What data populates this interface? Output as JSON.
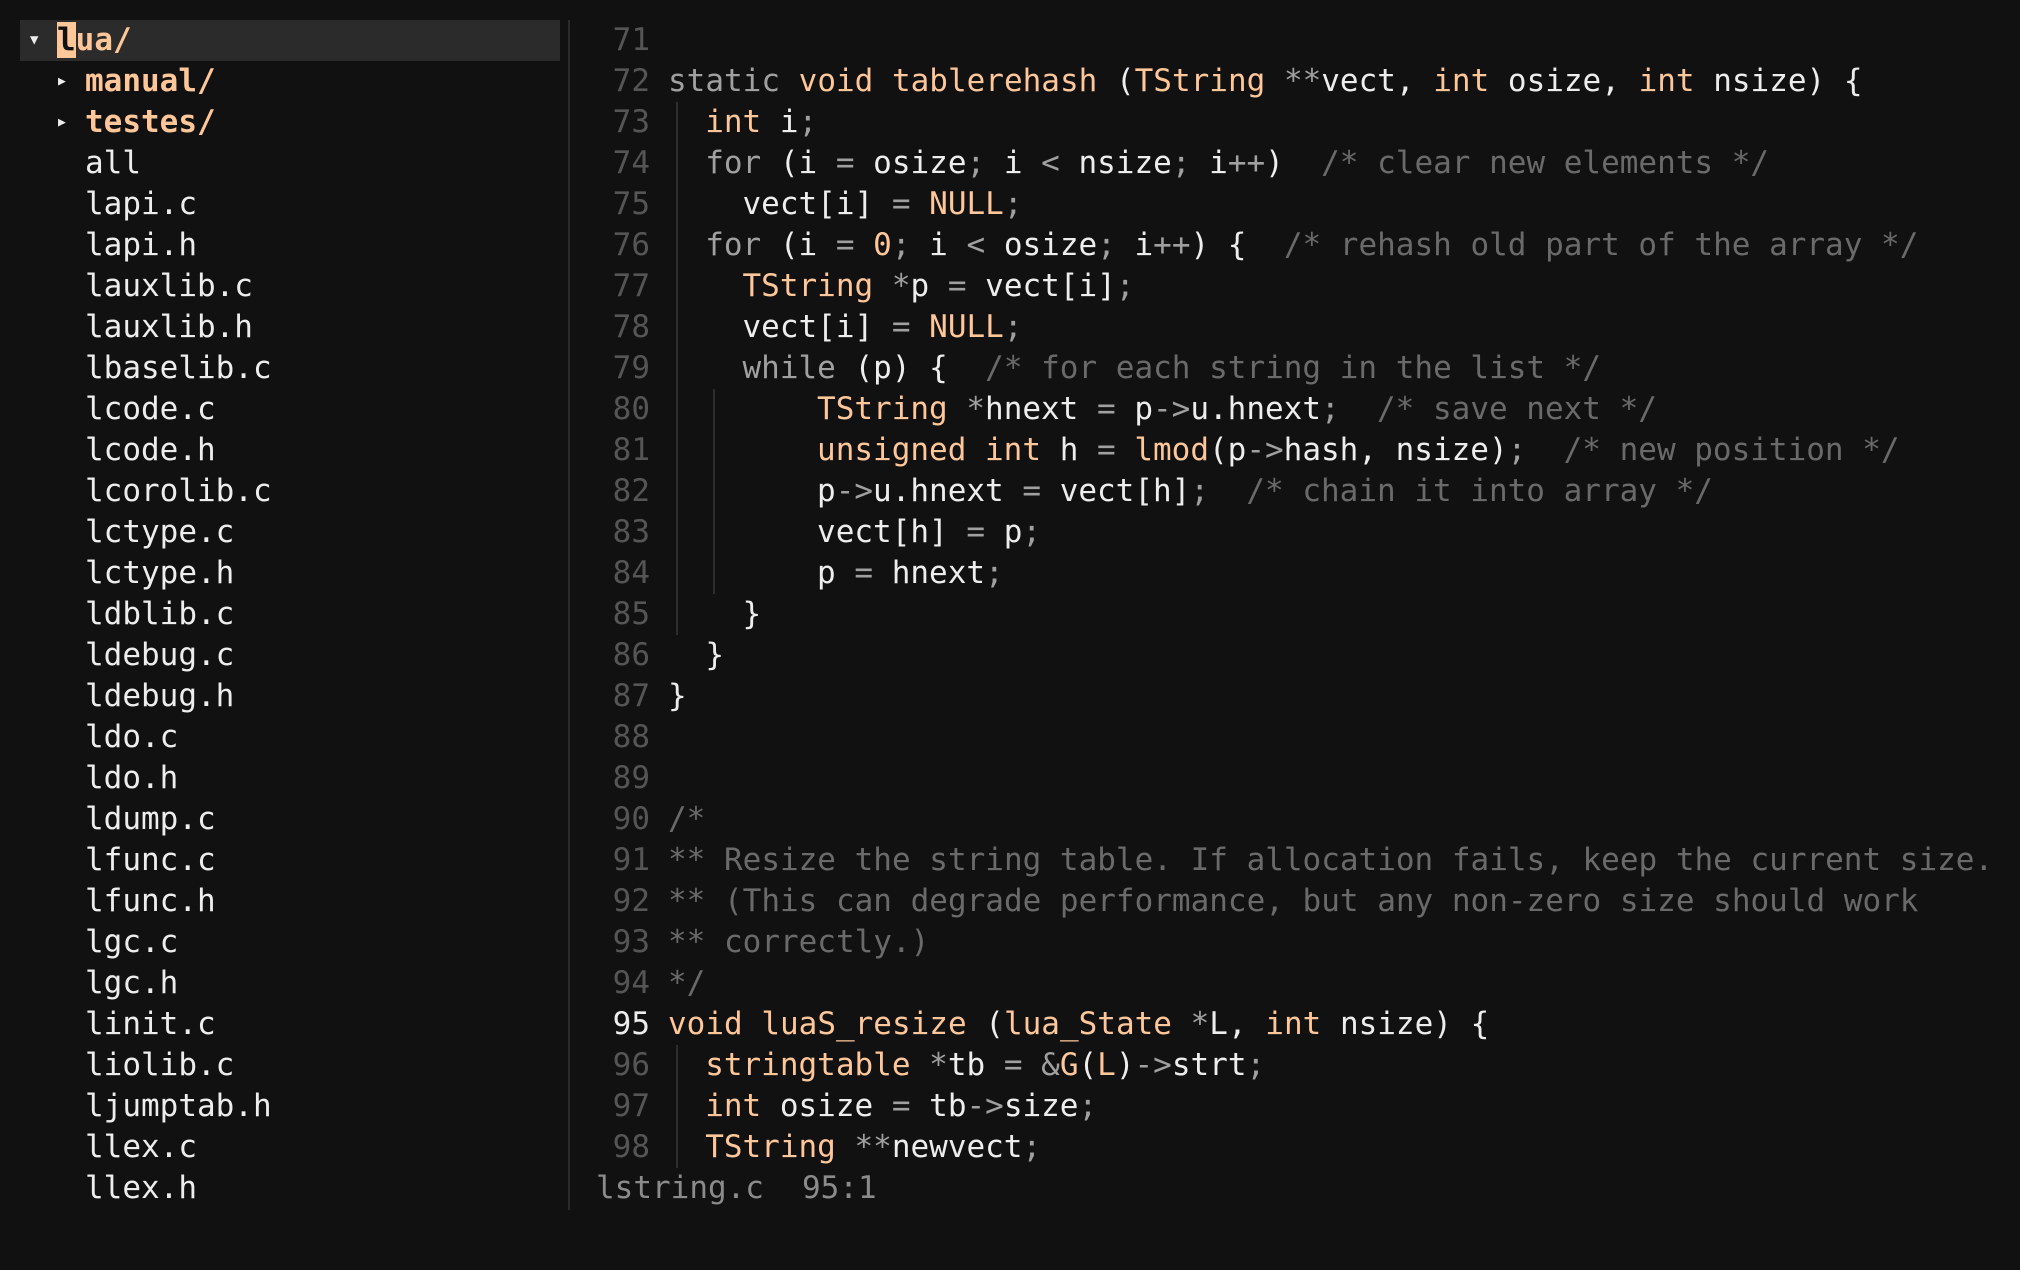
{
  "file_tree": {
    "items": [
      {
        "name": "lua/",
        "type": "dir",
        "expanded": true,
        "depth": 0,
        "selected": true
      },
      {
        "name": "manual/",
        "type": "dir",
        "expanded": false,
        "depth": 1
      },
      {
        "name": "testes/",
        "type": "dir",
        "expanded": false,
        "depth": 1
      },
      {
        "name": "all",
        "type": "file",
        "depth": 1
      },
      {
        "name": "lapi.c",
        "type": "file",
        "depth": 1
      },
      {
        "name": "lapi.h",
        "type": "file",
        "depth": 1
      },
      {
        "name": "lauxlib.c",
        "type": "file",
        "depth": 1
      },
      {
        "name": "lauxlib.h",
        "type": "file",
        "depth": 1
      },
      {
        "name": "lbaselib.c",
        "type": "file",
        "depth": 1
      },
      {
        "name": "lcode.c",
        "type": "file",
        "depth": 1
      },
      {
        "name": "lcode.h",
        "type": "file",
        "depth": 1
      },
      {
        "name": "lcorolib.c",
        "type": "file",
        "depth": 1
      },
      {
        "name": "lctype.c",
        "type": "file",
        "depth": 1
      },
      {
        "name": "lctype.h",
        "type": "file",
        "depth": 1
      },
      {
        "name": "ldblib.c",
        "type": "file",
        "depth": 1
      },
      {
        "name": "ldebug.c",
        "type": "file",
        "depth": 1
      },
      {
        "name": "ldebug.h",
        "type": "file",
        "depth": 1
      },
      {
        "name": "ldo.c",
        "type": "file",
        "depth": 1
      },
      {
        "name": "ldo.h",
        "type": "file",
        "depth": 1
      },
      {
        "name": "ldump.c",
        "type": "file",
        "depth": 1
      },
      {
        "name": "lfunc.c",
        "type": "file",
        "depth": 1
      },
      {
        "name": "lfunc.h",
        "type": "file",
        "depth": 1
      },
      {
        "name": "lgc.c",
        "type": "file",
        "depth": 1
      },
      {
        "name": "lgc.h",
        "type": "file",
        "depth": 1
      },
      {
        "name": "linit.c",
        "type": "file",
        "depth": 1
      },
      {
        "name": "liolib.c",
        "type": "file",
        "depth": 1
      },
      {
        "name": "ljumptab.h",
        "type": "file",
        "depth": 1
      },
      {
        "name": "llex.c",
        "type": "file",
        "depth": 1
      },
      {
        "name": "llex.h",
        "type": "file",
        "depth": 1
      }
    ]
  },
  "editor": {
    "current_line": 95,
    "lines": [
      {
        "n": "71",
        "guides": 0,
        "tokens": []
      },
      {
        "n": "72",
        "guides": 0,
        "tokens": [
          [
            "kwp",
            "static "
          ],
          [
            "kw",
            "void "
          ],
          [
            "fn",
            "tablerehash "
          ],
          [
            "plain",
            "("
          ],
          [
            "ty",
            "TString "
          ],
          [
            "op",
            "**"
          ],
          [
            "plain",
            "vect, "
          ],
          [
            "kw",
            "int "
          ],
          [
            "plain",
            "osize, "
          ],
          [
            "kw",
            "int "
          ],
          [
            "plain",
            "nsize) {"
          ]
        ]
      },
      {
        "n": "73",
        "guides": 1,
        "tokens": [
          [
            "kw",
            "int "
          ],
          [
            "plain",
            "i"
          ],
          [
            "op",
            ";"
          ]
        ]
      },
      {
        "n": "74",
        "guides": 1,
        "tokens": [
          [
            "kwp",
            "for "
          ],
          [
            "plain",
            "(i "
          ],
          [
            "op",
            "= "
          ],
          [
            "plain",
            "osize"
          ],
          [
            "op",
            "; "
          ],
          [
            "plain",
            "i "
          ],
          [
            "op",
            "< "
          ],
          [
            "plain",
            "nsize"
          ],
          [
            "op",
            "; "
          ],
          [
            "plain",
            "i"
          ],
          [
            "op",
            "++"
          ],
          [
            "plain",
            ")  "
          ],
          [
            "cm",
            "/* clear new elements */"
          ]
        ]
      },
      {
        "n": "75",
        "guides": 1,
        "tokens": [
          [
            "plain",
            "  vect[i] "
          ],
          [
            "op",
            "= "
          ],
          [
            "num",
            "NULL"
          ],
          [
            "op",
            ";"
          ]
        ]
      },
      {
        "n": "76",
        "guides": 1,
        "tokens": [
          [
            "kwp",
            "for "
          ],
          [
            "plain",
            "(i "
          ],
          [
            "op",
            "= "
          ],
          [
            "num",
            "0"
          ],
          [
            "op",
            "; "
          ],
          [
            "plain",
            "i "
          ],
          [
            "op",
            "< "
          ],
          [
            "plain",
            "osize"
          ],
          [
            "op",
            "; "
          ],
          [
            "plain",
            "i"
          ],
          [
            "op",
            "++"
          ],
          [
            "plain",
            ") {  "
          ],
          [
            "cm",
            "/* rehash old part of the array */"
          ]
        ]
      },
      {
        "n": "77",
        "guides": 1,
        "tokens": [
          [
            "plain",
            "  "
          ],
          [
            "ty",
            "TString "
          ],
          [
            "op",
            "*"
          ],
          [
            "plain",
            "p "
          ],
          [
            "op",
            "= "
          ],
          [
            "plain",
            "vect[i]"
          ],
          [
            "op",
            ";"
          ]
        ]
      },
      {
        "n": "78",
        "guides": 1,
        "tokens": [
          [
            "plain",
            "  vect[i] "
          ],
          [
            "op",
            "= "
          ],
          [
            "num",
            "NULL"
          ],
          [
            "op",
            ";"
          ]
        ]
      },
      {
        "n": "79",
        "guides": 1,
        "tokens": [
          [
            "plain",
            "  "
          ],
          [
            "kwp",
            "while "
          ],
          [
            "plain",
            "(p) {  "
          ],
          [
            "cm",
            "/* for each string in the list */"
          ]
        ]
      },
      {
        "n": "80",
        "guides": 2,
        "tokens": [
          [
            "plain",
            "    "
          ],
          [
            "ty",
            "TString "
          ],
          [
            "op",
            "*"
          ],
          [
            "plain",
            "hnext "
          ],
          [
            "op",
            "= "
          ],
          [
            "plain",
            "p"
          ],
          [
            "op",
            "->"
          ],
          [
            "plain",
            "u.hnext"
          ],
          [
            "op",
            ";  "
          ],
          [
            "cm",
            "/* save next */"
          ]
        ]
      },
      {
        "n": "81",
        "guides": 2,
        "tokens": [
          [
            "plain",
            "    "
          ],
          [
            "kw",
            "unsigned int "
          ],
          [
            "plain",
            "h "
          ],
          [
            "op",
            "= "
          ],
          [
            "fn",
            "lmod"
          ],
          [
            "plain",
            "(p"
          ],
          [
            "op",
            "->"
          ],
          [
            "plain",
            "hash, nsize)"
          ],
          [
            "op",
            ";  "
          ],
          [
            "cm",
            "/* new position */"
          ]
        ]
      },
      {
        "n": "82",
        "guides": 2,
        "tokens": [
          [
            "plain",
            "    p"
          ],
          [
            "op",
            "->"
          ],
          [
            "plain",
            "u.hnext "
          ],
          [
            "op",
            "= "
          ],
          [
            "plain",
            "vect[h]"
          ],
          [
            "op",
            ";  "
          ],
          [
            "cm",
            "/* chain it into array */"
          ]
        ]
      },
      {
        "n": "83",
        "guides": 2,
        "tokens": [
          [
            "plain",
            "    vect[h] "
          ],
          [
            "op",
            "= "
          ],
          [
            "plain",
            "p"
          ],
          [
            "op",
            ";"
          ]
        ]
      },
      {
        "n": "84",
        "guides": 2,
        "tokens": [
          [
            "plain",
            "    p "
          ],
          [
            "op",
            "= "
          ],
          [
            "plain",
            "hnext"
          ],
          [
            "op",
            ";"
          ]
        ]
      },
      {
        "n": "85",
        "guides": 1,
        "tokens": [
          [
            "plain",
            "  }"
          ]
        ]
      },
      {
        "n": "86",
        "guides": 0,
        "tokens": [
          [
            "plain",
            "  }"
          ]
        ]
      },
      {
        "n": "87",
        "guides": 0,
        "tokens": [
          [
            "plain",
            "}"
          ]
        ]
      },
      {
        "n": "88",
        "guides": 0,
        "tokens": []
      },
      {
        "n": "89",
        "guides": 0,
        "tokens": []
      },
      {
        "n": "90",
        "guides": 0,
        "tokens": [
          [
            "cm",
            "/*"
          ]
        ]
      },
      {
        "n": "91",
        "guides": 0,
        "tokens": [
          [
            "cm",
            "** Resize the string table. If allocation fails, keep the current size."
          ]
        ]
      },
      {
        "n": "92",
        "guides": 0,
        "tokens": [
          [
            "cm",
            "** (This can degrade performance, but any non-zero size should work"
          ]
        ]
      },
      {
        "n": "93",
        "guides": 0,
        "tokens": [
          [
            "cm",
            "** correctly.)"
          ]
        ]
      },
      {
        "n": "94",
        "guides": 0,
        "tokens": [
          [
            "cm",
            "*/"
          ]
        ]
      },
      {
        "n": "95",
        "guides": 0,
        "tokens": [
          [
            "kw",
            "void "
          ],
          [
            "fn",
            "luaS_resize "
          ],
          [
            "plain",
            "("
          ],
          [
            "ty",
            "lua_State "
          ],
          [
            "op",
            "*"
          ],
          [
            "plain",
            "L, "
          ],
          [
            "kw",
            "int "
          ],
          [
            "plain",
            "nsize) {"
          ]
        ]
      },
      {
        "n": "96",
        "guides": 1,
        "tokens": [
          [
            "ty",
            "stringtable "
          ],
          [
            "op",
            "*"
          ],
          [
            "plain",
            "tb "
          ],
          [
            "op",
            "= &"
          ],
          [
            "fn",
            "G"
          ],
          [
            "plain",
            "("
          ],
          [
            "num",
            "L"
          ],
          [
            "plain",
            ")"
          ],
          [
            "op",
            "->"
          ],
          [
            "plain",
            "strt"
          ],
          [
            "op",
            ";"
          ]
        ]
      },
      {
        "n": "97",
        "guides": 1,
        "tokens": [
          [
            "kw",
            "int "
          ],
          [
            "plain",
            "osize "
          ],
          [
            "op",
            "= "
          ],
          [
            "plain",
            "tb"
          ],
          [
            "op",
            "->"
          ],
          [
            "plain",
            "size"
          ],
          [
            "op",
            ";"
          ]
        ]
      },
      {
        "n": "98",
        "guides": 1,
        "tokens": [
          [
            "ty",
            "TString "
          ],
          [
            "op",
            "**"
          ],
          [
            "plain",
            "newvect"
          ],
          [
            "op",
            ";"
          ]
        ]
      }
    ]
  },
  "status": {
    "filename": "lstring.c",
    "position": "95:1"
  },
  "colors": {
    "background": "#111111",
    "accent": "#ffc799",
    "text": "#ededed",
    "comment": "#6a6a6a",
    "line_number": "#555555",
    "selected_row": "#2b2b2b"
  }
}
